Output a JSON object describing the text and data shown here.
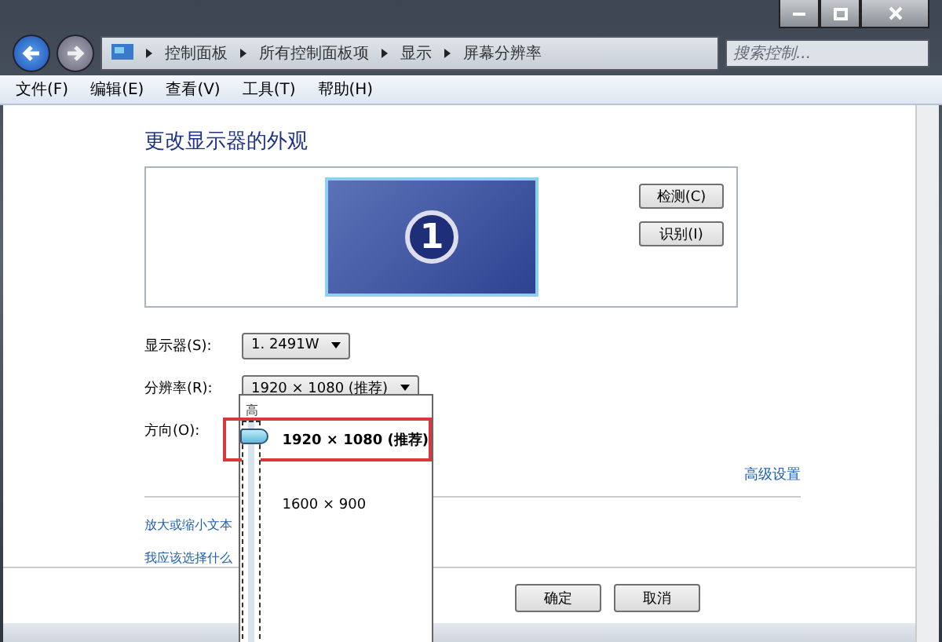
{
  "address_bar": {
    "path": [
      "控制面板",
      "所有控制面板项",
      "显示",
      "屏幕分辨率"
    ]
  },
  "search": {
    "placeholder": "搜索控制..."
  },
  "menu": [
    "文件(F)",
    "编辑(E)",
    "查看(V)",
    "工具(T)",
    "帮助(H)"
  ],
  "heading": "更改显示器的外观",
  "preview": {
    "monitor_number": "1",
    "buttons": [
      "检测(C)",
      "识别(I)"
    ]
  },
  "settings": [
    {
      "label": "显示器(S):",
      "value": "1. 2491W"
    },
    {
      "label": "分辨率(R):",
      "value": "1920 × 1080 (推荐)"
    },
    {
      "label": "方向(O):"
    }
  ],
  "resolution_popup": {
    "top_label": "高",
    "level": 1,
    "options": [
      {
        "label": "1920 × 1080 (推荐)",
        "selected": true
      },
      {
        "label": "1600 × 900",
        "selected": false
      }
    ]
  },
  "advanced_link": "高级设置",
  "links": [
    "放大或缩小文本",
    "我应该选择什么"
  ],
  "buttons": [
    "确定",
    "取消"
  ]
}
